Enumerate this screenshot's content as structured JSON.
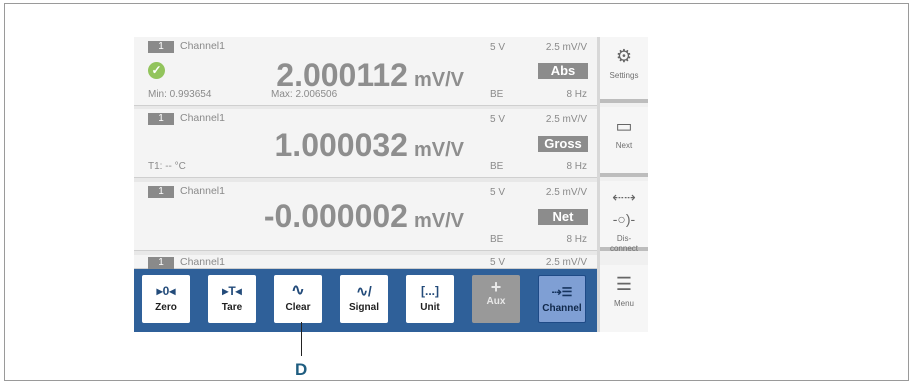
{
  "channels": [
    {
      "badge": "1",
      "name": "Channel1",
      "value": "2.000112",
      "unit": "mV/V",
      "range": "5 V",
      "sensitivity": "2.5 mV/V",
      "mode": "Abs",
      "bridge": "BE",
      "filter": "8 Hz",
      "min": "Min: 0.993654",
      "max": "Max: 2.006506",
      "status_icon": "check-icon"
    },
    {
      "badge": "1",
      "name": "Channel1",
      "value": "1.000032",
      "unit": "mV/V",
      "range": "5 V",
      "sensitivity": "2.5 mV/V",
      "mode": "Gross",
      "bridge": "BE",
      "filter": "8 Hz",
      "info": "T1: -- °C"
    },
    {
      "badge": "1",
      "name": "Channel1",
      "value": "-0.000002",
      "unit": "mV/V",
      "range": "5 V",
      "sensitivity": "2.5 mV/V",
      "mode": "Net",
      "bridge": "BE",
      "filter": "8 Hz"
    },
    {
      "badge": "1",
      "name": "Channel1",
      "range": "5 V",
      "sensitivity": "2.5 mV/V"
    }
  ],
  "side_buttons": {
    "settings": {
      "label": "Settings",
      "icon": "gear-icon"
    },
    "next": {
      "label": "Next",
      "icon": "screen-icon"
    },
    "disconnect": {
      "label1": "Dis-",
      "label2": "connect",
      "icon": "disconnect-icon"
    },
    "menu": {
      "label": "Menu",
      "icon": "list-icon"
    }
  },
  "toolbar": {
    "zero": {
      "label": "Zero",
      "glyph": "▸0◂"
    },
    "tare": {
      "label": "Tare",
      "glyph": "▸T◂"
    },
    "clear": {
      "label": "Clear",
      "glyph": "∿"
    },
    "signal": {
      "label": "Signal",
      "glyph": "∿/"
    },
    "unit": {
      "label": "Unit",
      "glyph": "[...]"
    },
    "aux": {
      "label": "Aux",
      "glyph": "+"
    },
    "channel": {
      "label": "Channel",
      "glyph": "⇢☰"
    }
  },
  "callout": {
    "label": "D"
  },
  "colors": {
    "toolbar_bg": "#2f6099",
    "active_button": "#7f9fd4",
    "ok_green": "#92c45c"
  }
}
